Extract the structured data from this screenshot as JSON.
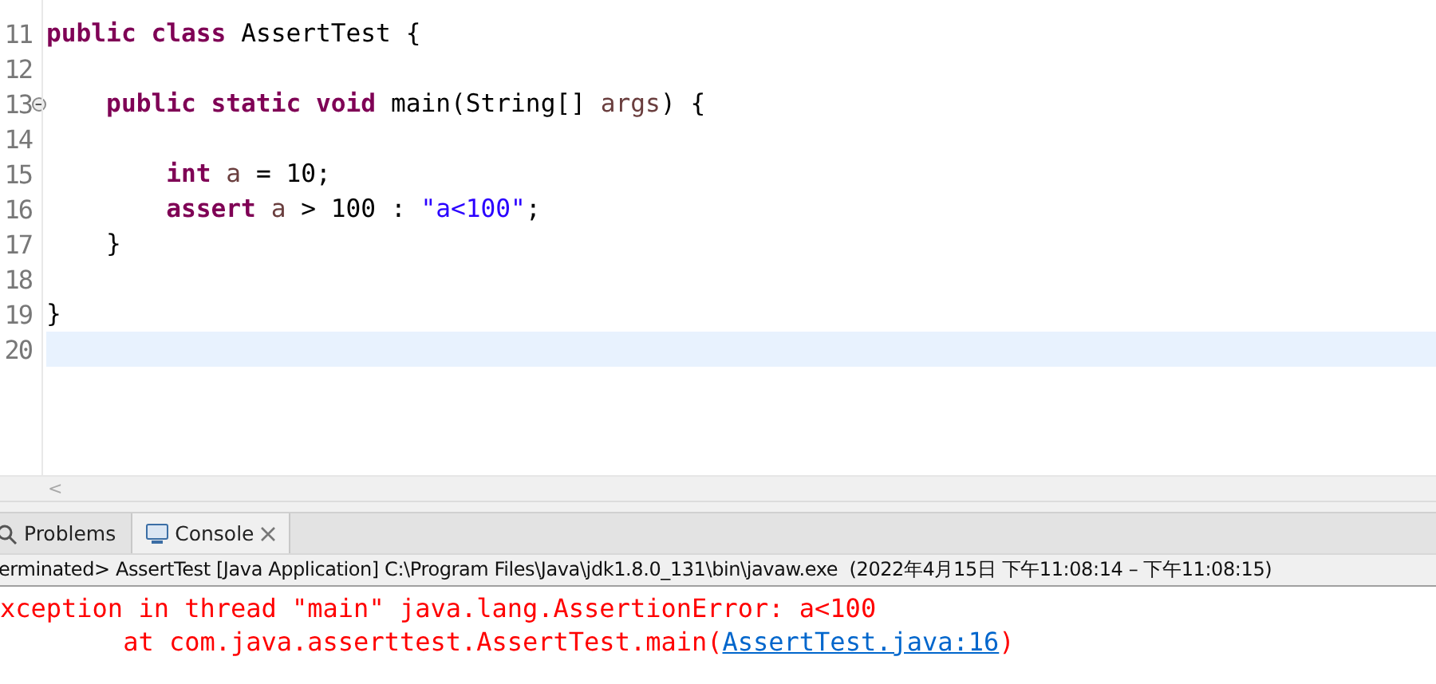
{
  "editor": {
    "lines": [
      {
        "number": "11",
        "current": false,
        "tokens": [
          {
            "kind": "keyword",
            "text": "public class "
          },
          {
            "kind": "plain",
            "text": "AssertTest {"
          }
        ]
      },
      {
        "number": "12",
        "current": false
      },
      {
        "number": "13",
        "current": false,
        "collapsed": false,
        "tokens": [
          {
            "kind": "keyword",
            "text": "    public static void "
          },
          {
            "kind": "plain",
            "text": "main(String[] "
          },
          {
            "kind": "variable",
            "text": "args"
          },
          {
            "kind": "plain",
            "text": ") {"
          }
        ]
      },
      {
        "number": "14",
        "current": false
      },
      {
        "number": "15",
        "current": false,
        "tokens": [
          {
            "kind": "keyword",
            "text": "        int "
          },
          {
            "kind": "variable",
            "text": "a "
          },
          {
            "kind": "plain",
            "text": "= 10;"
          }
        ]
      },
      {
        "number": "16",
        "current": false,
        "tokens": [
          {
            "kind": "keyword",
            "text": "        assert "
          },
          {
            "kind": "variable",
            "text": "a "
          },
          {
            "kind": "plain",
            "text": "> 100 : "
          },
          {
            "kind": "string",
            "text": "\"a<100\""
          },
          {
            "kind": "plain",
            "text": ";"
          }
        ]
      },
      {
        "number": "17",
        "current": false,
        "tokens": [
          {
            "kind": "plain",
            "text": "    }"
          }
        ]
      },
      {
        "number": "18",
        "current": false
      },
      {
        "number": "19",
        "current": false,
        "tokens": [
          {
            "kind": "plain",
            "text": "}"
          }
        ]
      },
      {
        "number": "20",
        "current": true
      }
    ]
  },
  "scrollbar": {
    "arrow": "<"
  },
  "panel": {
    "tabs": [
      {
        "label": "Problems",
        "selected": false
      },
      {
        "label": "Console",
        "selected": true,
        "closable": true
      }
    ],
    "status": "erminated> AssertTest [Java Application] C:\\Program Files\\Java\\jdk1.8.0_131\\bin\\javaw.exe  (2022年4月15日 下午11:08:14 – 下午11:08:15)",
    "output": [
      {
        "tokens": [
          {
            "kind": "error",
            "text": "xception in thread \"main\" java.lang.AssertionError: a<100"
          }
        ]
      },
      {
        "tokens": [
          {
            "kind": "error",
            "text": "        at com.java.asserttest.AssertTest.main("
          },
          {
            "kind": "link",
            "text": "AssertTest.java:16"
          },
          {
            "kind": "error",
            "text": ")"
          }
        ]
      }
    ]
  }
}
